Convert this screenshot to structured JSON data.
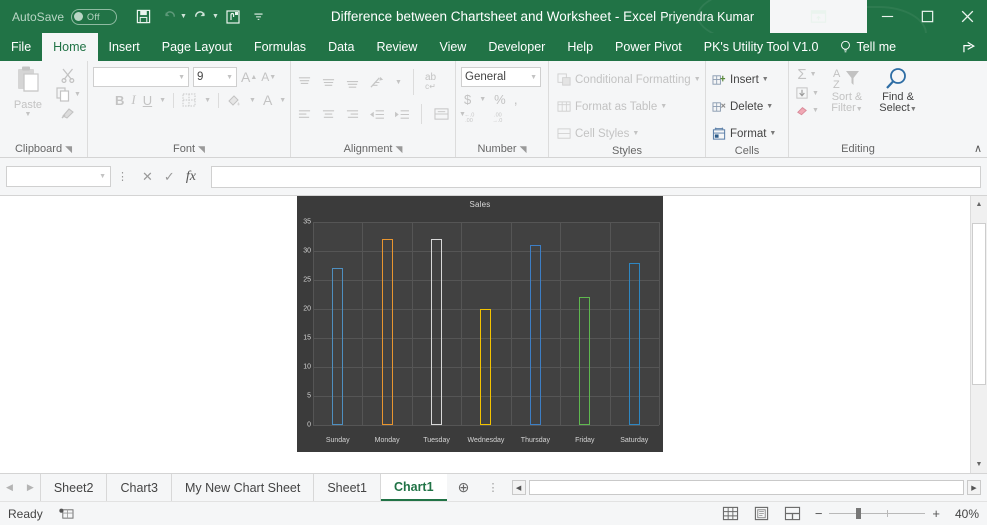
{
  "titlebar": {
    "autosave_label": "AutoSave",
    "autosave_state": "Off",
    "window_title": "Difference between Chartsheet and Worksheet  -  Excel",
    "username": "Priyendra Kumar",
    "qat": [
      {
        "name": "save-icon",
        "glyph": "ὋE"
      },
      {
        "name": "undo-icon",
        "glyph": "↶"
      },
      {
        "name": "redo-icon",
        "glyph": "↷"
      },
      {
        "name": "touch-mode-icon",
        "glyph": "✋"
      },
      {
        "name": "customize-qat-icon",
        "glyph": "▾"
      }
    ],
    "window_buttons": {
      "ribbon_display": "⬜",
      "minimize": "—",
      "maximize": "☐",
      "close": "✕"
    }
  },
  "ribbon_tabs": [
    {
      "label": "File",
      "active": false
    },
    {
      "label": "Home",
      "active": true
    },
    {
      "label": "Insert",
      "active": false
    },
    {
      "label": "Page Layout",
      "active": false
    },
    {
      "label": "Formulas",
      "active": false
    },
    {
      "label": "Data",
      "active": false
    },
    {
      "label": "Review",
      "active": false
    },
    {
      "label": "View",
      "active": false
    },
    {
      "label": "Developer",
      "active": false
    },
    {
      "label": "Help",
      "active": false
    },
    {
      "label": "Power Pivot",
      "active": false
    },
    {
      "label": "PK's Utility Tool V1.0",
      "active": false
    }
  ],
  "tell_me": "Tell me",
  "ribbon": {
    "clipboard": {
      "label": "Clipboard",
      "paste_label": "Paste",
      "cut_label": "Cut",
      "copy_label": "Copy",
      "format_painter_label": "Format Painter"
    },
    "font": {
      "label": "Font",
      "font_name": "",
      "font_size": "9",
      "grow_font": "A",
      "shrink_font": "A",
      "bold": "B",
      "italic": "I",
      "underline": "U",
      "borders_label": "Borders",
      "fill_color_label": "Fill Color",
      "font_color_label": "Font Color"
    },
    "alignment": {
      "label": "Alignment",
      "orientation_label": "Orientation",
      "wrap_text_label": "Wrap Text",
      "merge_label": "Merge & Center",
      "wrap_glyph": "ab"
    },
    "number": {
      "label": "Number",
      "format": "General",
      "currency": "$",
      "percent": "%",
      "comma": ",",
      "decrease_decimal": ".00",
      "increase_decimal": ".00"
    },
    "styles": {
      "label": "Styles",
      "items": [
        "Conditional Formatting",
        "Format as Table",
        "Cell Styles"
      ]
    },
    "cells": {
      "label": "Cells",
      "items": [
        "Insert",
        "Delete",
        "Format"
      ]
    },
    "editing": {
      "label": "Editing",
      "autosum": "Σ",
      "fill_label": "Fill",
      "clear_label": "Clear",
      "sort_filter": "Sort &\nFilter",
      "sort_filter_line1": "Sort &",
      "sort_filter_line2": "Filter",
      "find_select_line1": "Find &",
      "find_select_line2": "Select"
    },
    "collapse_glyph": "∧"
  },
  "formula_bar": {
    "name_box_value": "",
    "cancel_glyph": "✕",
    "enter_glyph": "✓",
    "fx_glyph": "fx",
    "formula_value": ""
  },
  "chart_data": {
    "type": "bar",
    "title": "Sales",
    "categories": [
      "Sunday",
      "Monday",
      "Tuesday",
      "Wednesday",
      "Thursday",
      "Friday",
      "Saturday"
    ],
    "values": [
      27,
      32,
      32,
      20,
      31,
      22,
      28
    ],
    "bar_colors": [
      "#4e8fc0",
      "#e8952f",
      "#d9d9d9",
      "#f2c200",
      "#3d7ec4",
      "#5fb84f",
      "#2e86c1"
    ],
    "xlabel": "",
    "ylabel": "",
    "ylim": [
      0,
      35
    ],
    "yticks": [
      0,
      5,
      10,
      15,
      20,
      25,
      30,
      35
    ],
    "grid": true,
    "legend": "none",
    "plot_background": "#414141",
    "chart_background": "#3b3b3b",
    "text_color": "#d4d4d4"
  },
  "sheet_tabs": {
    "prev_glyph": "◀",
    "next_glyph": "▶",
    "tabs": [
      {
        "label": "Sheet2",
        "active": false
      },
      {
        "label": "Chart3",
        "active": false
      },
      {
        "label": "My New Chart Sheet",
        "active": false
      },
      {
        "label": "Sheet1",
        "active": false
      },
      {
        "label": "Chart1",
        "active": true
      }
    ],
    "add_sheet_glyph": "⊕"
  },
  "status_bar": {
    "status": "Ready",
    "accessibility_icon": "recording-icon",
    "views": [
      "normal-view",
      "page-layout-view",
      "page-break-view"
    ],
    "zoom_out": "−",
    "zoom_in": "+",
    "zoom_value": "40%"
  },
  "colors": {
    "brand_green": "#217346",
    "ribbon_bg": "#f5f6f7",
    "active_tab_green": "#217346"
  }
}
